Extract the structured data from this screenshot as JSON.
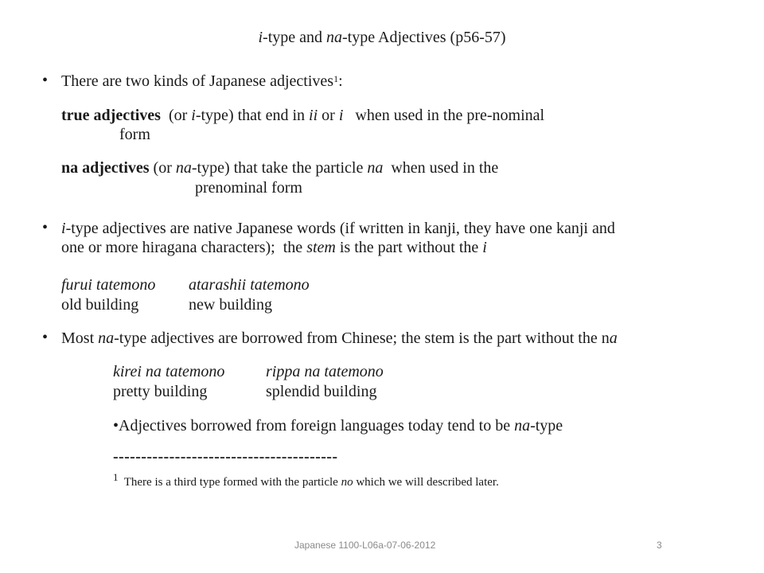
{
  "slide": {
    "title": {
      "italic1": "i",
      "text1": "-type and ",
      "italic2": "na",
      "text2": "-type Adjectives (p56-57)"
    },
    "bullet1": {
      "text": "There are two kinds of Japanese adjectives",
      "sup": "1",
      "tail": ":"
    },
    "true_adj": {
      "bold": "true adjectives",
      "t1": "  (or ",
      "i1": "i",
      "t2": "-type) that end in ",
      "i2": "ii",
      "t3": " or ",
      "i3": "i",
      "t4": "   when used in the pre-nominal",
      "line2": "form"
    },
    "na_adj": {
      "bold": "na adjectives",
      "t1": " (or ",
      "i1": "na",
      "t2": "-type) that take the particle ",
      "i2": "na",
      "t3": "  when used in the",
      "line2": "prenominal form"
    },
    "bullet2": {
      "i1": "i",
      "t1": "-type adjectives are native Japanese words (if written in kanji, they have one kanji and",
      "line2a": "one or more hiragana characters);  the ",
      "i2": "stem",
      "line2b": " is the part without the ",
      "i3": "i"
    },
    "example1": {
      "jp1": "furui tatemono",
      "jp2": "atarashii tatemono",
      "en1": "old building",
      "en2": "new building"
    },
    "bullet3": {
      "t1": "Most ",
      "i1": "na",
      "t2": "-type adjectives are borrowed from Chinese; the stem is the part without the n",
      "i2": "a"
    },
    "example2": {
      "jp1": "kirei na tatemono",
      "jp2": "rippa na tatemono",
      "en1": "pretty building",
      "en2": "splendid building"
    },
    "sub_bullet": {
      "t1": "•Adjectives borrowed from foreign languages today tend to be ",
      "i1": "na",
      "t2": "-type"
    },
    "separator": "----------------------------------------",
    "footnote": {
      "sup": "1",
      "t1": "  There is a third type formed with the particle ",
      "i1": "no",
      "t2": " which we will described later."
    },
    "bullet_glyph": "•"
  },
  "footer": {
    "label": "Japanese 1100-L06a-07-06-2012",
    "page_number": "3"
  }
}
